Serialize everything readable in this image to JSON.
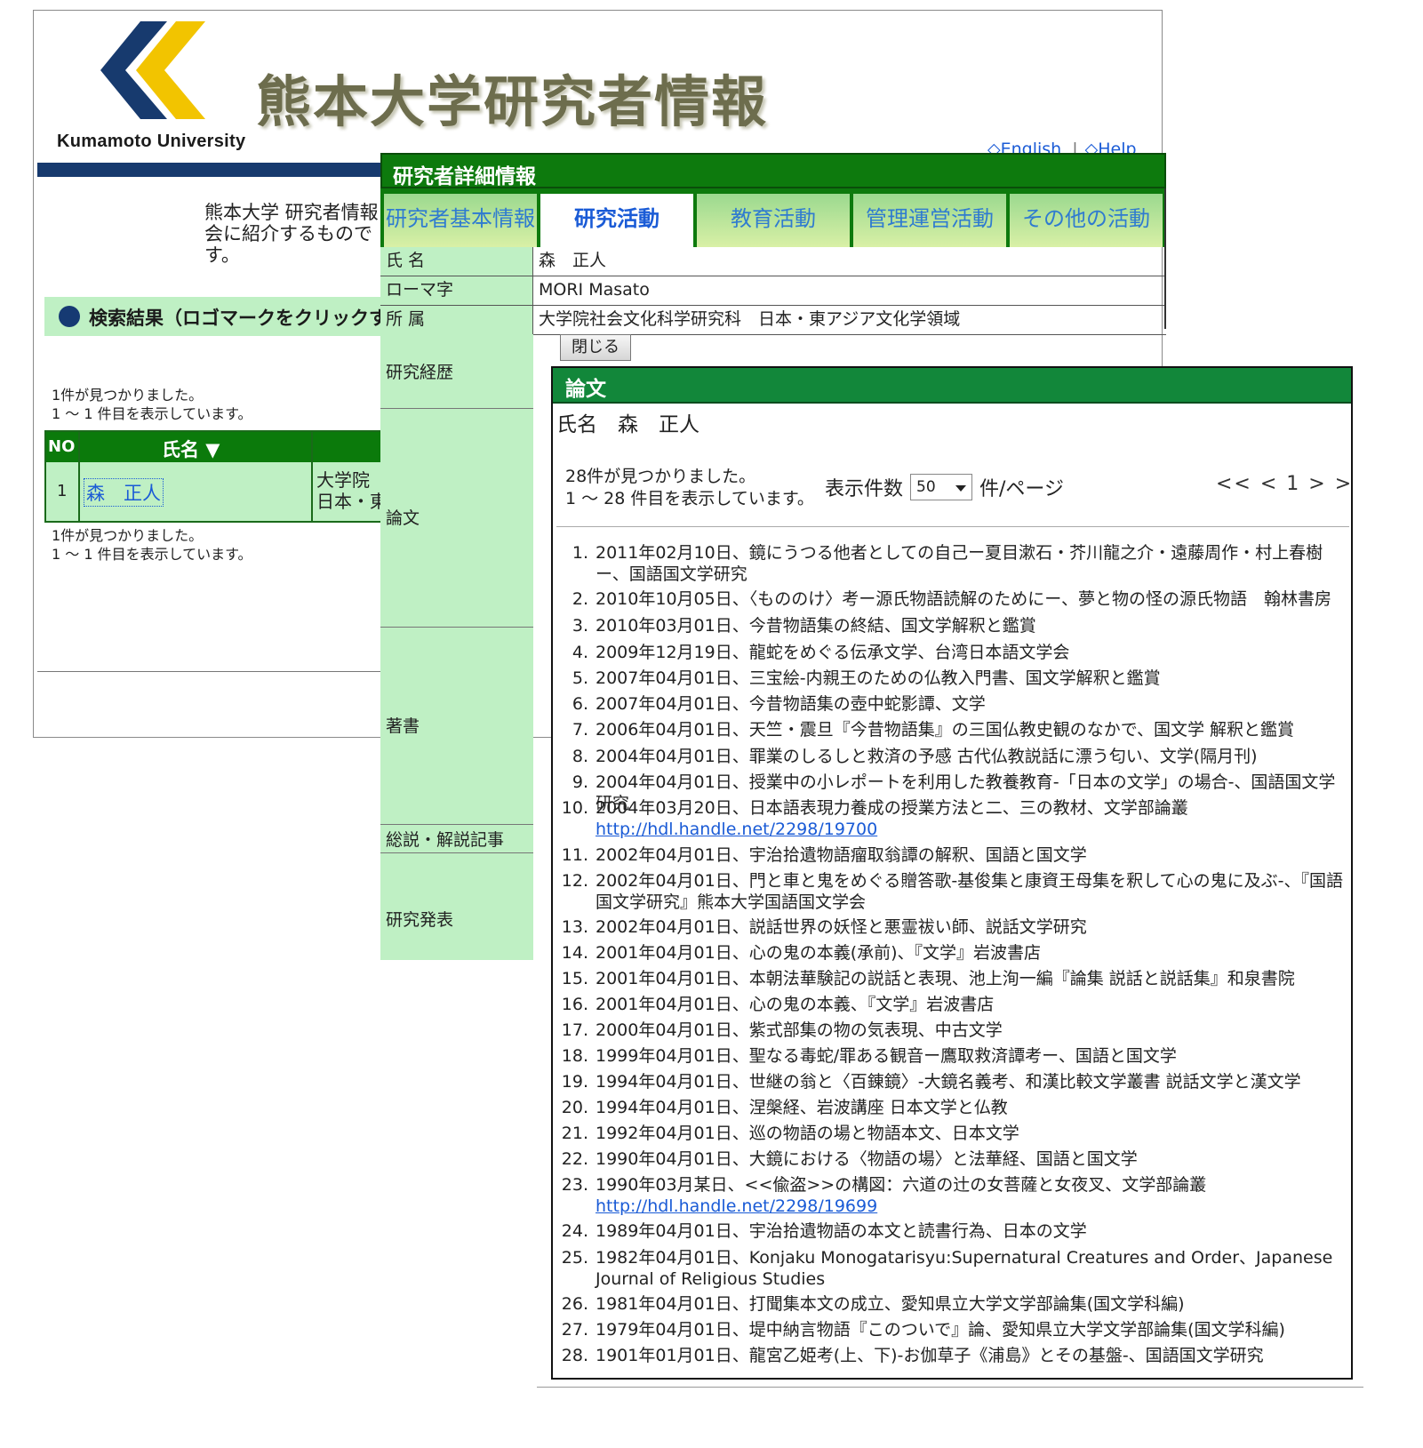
{
  "search_page": {
    "university_name": "Kumamoto University",
    "site_title": "熊本大学研究者情報",
    "english_link": "◇English",
    "help_link": "◇Help",
    "link_separator": "|",
    "intro": "熊本大学 研究者情報\n会に紹介するもので\nす。",
    "results_header": "検索結果（ロゴマークをクリックする",
    "count_top": "1件が見つかりました。\n1 ～ 1 件目を表示しています。",
    "count_bottom": "1件が見つかりました。\n1 ～ 1 件目を表示しています。",
    "table": {
      "col_no": "NO",
      "col_name": "氏名 ▼",
      "row_no": "1",
      "row_name": "森　正人",
      "row_affiliation": "大学院\n日本・東"
    },
    "colors": {
      "brand_navy": "#173a6e",
      "logo_yellow": "#f2c400",
      "header_green": "#0b7a0b"
    }
  },
  "detail_page": {
    "title": "研究者詳細情報",
    "tabs": [
      {
        "label": "研究者基本情報",
        "active": false
      },
      {
        "label": "研究活動",
        "active": true
      },
      {
        "label": "教育活動",
        "active": false
      },
      {
        "label": "管理運営活動",
        "active": false
      },
      {
        "label": "その他の活動",
        "active": false
      }
    ],
    "fields": [
      {
        "label": "氏 名",
        "value": "森　正人"
      },
      {
        "label": "ローマ字",
        "value": "MORI Masato"
      },
      {
        "label": "所 属",
        "value": "大学院社会文化科学研究科　日本・東アジア文化学領域"
      }
    ],
    "close_button": "閉じる",
    "categories": [
      "研究経歴",
      "論文",
      "著書",
      "総説・解説記事",
      "研究発表"
    ]
  },
  "papers_page": {
    "title": "論文",
    "person": "氏名　森　正人",
    "count_text": "28件が見つかりました。\n1 ～ 28 件目を表示しています。",
    "per_page_label": "表示件数",
    "per_page_value": "50",
    "per_page_suffix": "件/ページ",
    "pager": "<< < 1 > >>",
    "items": [
      {
        "num": "1.",
        "text": "2011年02月10日、鏡にうつる他者としての自己ー夏目漱石・芥川龍之介・遠藤周作・村上春樹ー、国語国文学研究"
      },
      {
        "num": "2.",
        "text": "2010年10月05日、〈もののけ〉考ー源氏物語読解のためにー、夢と物の怪の源氏物語　翰林書房"
      },
      {
        "num": "3.",
        "text": "2010年03月01日、今昔物語集の終結、国文学解釈と鑑賞"
      },
      {
        "num": "4.",
        "text": "2009年12月19日、龍蛇をめぐる伝承文学、台湾日本語文学会"
      },
      {
        "num": "5.",
        "text": "2007年04月01日、三宝絵‐内親王のための仏教入門書、国文学解釈と鑑賞"
      },
      {
        "num": "6.",
        "text": "2007年04月01日、今昔物語集の壺中蛇影譚、文学"
      },
      {
        "num": "7.",
        "text": "2006年04月01日、天竺・震旦『今昔物語集』の三国仏教史観のなかで、国文学 解釈と鑑賞"
      },
      {
        "num": "8.",
        "text": "2004年04月01日、罪業のしるしと救済の予感 古代仏教説話に漂う匂い、文学(隔月刊)"
      },
      {
        "num": "9.",
        "text": "2004年04月01日、授業中の小レポートを利用した教養教育‐「日本の文学」の場合‐、国語国文学研究"
      },
      {
        "num": "10.",
        "text": "2004年03月20日、日本語表現力養成の授業方法と二、三の教材、文学部論叢",
        "link": "http://hdl.handle.net/2298/19700"
      },
      {
        "num": "11.",
        "text": "2002年04月01日、宇治拾遺物語瘤取翁譚の解釈、国語と国文学"
      },
      {
        "num": "12.",
        "text": "2002年04月01日、門と車と鬼をめぐる贈答歌‐基俊集と康資王母集を釈して心の鬼に及ぶ‐、『国語国文学研究』熊本大学国語国文学会"
      },
      {
        "num": "13.",
        "text": "2002年04月01日、説話世界の妖怪と悪霊祓い師、説話文学研究"
      },
      {
        "num": "14.",
        "text": "2001年04月01日、心の鬼の本義(承前)、『文学』岩波書店"
      },
      {
        "num": "15.",
        "text": "2001年04月01日、本朝法華験記の説話と表現、池上洵一編『論集 説話と説話集』和泉書院"
      },
      {
        "num": "16.",
        "text": "2001年04月01日、心の鬼の本義、『文学』岩波書店"
      },
      {
        "num": "17.",
        "text": "2000年04月01日、紫式部集の物の気表現、中古文学"
      },
      {
        "num": "18.",
        "text": "1999年04月01日、聖なる毒蛇/罪ある観音ー鷹取救済譚考ー、国語と国文学"
      },
      {
        "num": "19.",
        "text": "1994年04月01日、世継の翁と〈百錬鏡〉‐大鏡名義考、和漢比較文学叢書 説話文学と漢文学"
      },
      {
        "num": "20.",
        "text": "1994年04月01日、涅槃経、岩波講座 日本文学と仏教"
      },
      {
        "num": "21.",
        "text": "1992年04月01日、巡の物語の場と物語本文、日本文学"
      },
      {
        "num": "22.",
        "text": "1990年04月01日、大鏡における〈物語の場〉と法華経、国語と国文学"
      },
      {
        "num": "23.",
        "text": "1990年03月某日、<<偸盗>>の構図：六道の辻の女菩薩と女夜叉、文学部論叢",
        "link": "http://hdl.handle.net/2298/19699"
      },
      {
        "num": "24.",
        "text": "1989年04月01日、宇治拾遺物語の本文と読書行為、日本の文学"
      },
      {
        "num": "25.",
        "text": "1982年04月01日、Konjaku Monogatarisyu:Supernatural Creatures and Order、Japanese Journal of Religious Studies"
      },
      {
        "num": "26.",
        "text": "1981年04月01日、打聞集本文の成立、愛知県立大学文学部論集(国文学科編)"
      },
      {
        "num": "27.",
        "text": "1979年04月01日、堤中納言物語『このついで』論、愛知県立大学文学部論集(国文学科編)"
      },
      {
        "num": "28.",
        "text": "1901年01月01日、龍宮乙姫考(上、下)‐お伽草子《浦島》とその基盤‐、国語国文学研究"
      }
    ]
  }
}
